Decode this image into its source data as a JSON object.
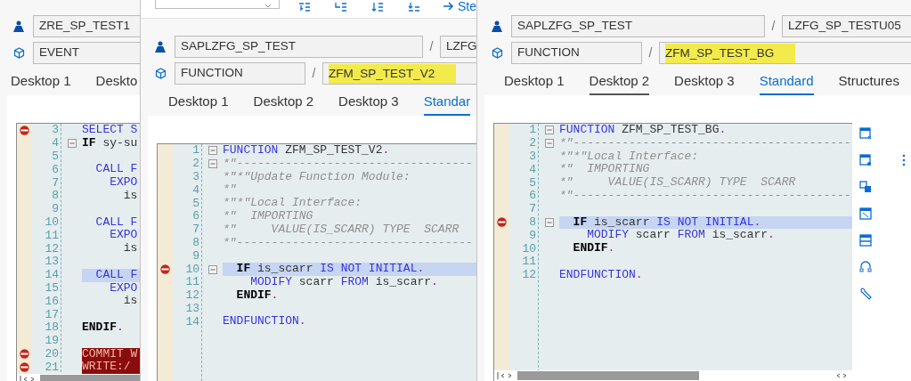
{
  "windows": [
    {
      "rows": [
        {
          "kind": "program",
          "items": [
            {
              "kind": "field",
              "value": "ZRE_SP_TEST1",
              "highlighted": false
            }
          ]
        },
        {
          "kind": "object",
          "items": [
            {
              "kind": "field",
              "value": "EVENT",
              "highlighted": false
            }
          ]
        }
      ],
      "tabs": [
        {
          "label": "Desktop 1",
          "selected": false,
          "focused": false
        },
        {
          "label": "Deskto",
          "selected": false,
          "focused": false
        }
      ],
      "editor": {
        "hscroll": true,
        "lines": [
          {
            "number": "3",
            "breakpoint": true,
            "fold": false,
            "current": false,
            "error": false,
            "segments": [
              {
                "kind": "keyword",
                "text": "SELECT S"
              }
            ]
          },
          {
            "number": "4",
            "breakpoint": false,
            "fold": true,
            "current": false,
            "error": false,
            "segments": [
              {
                "kind": "strong",
                "text": "IF"
              },
              {
                "kind": "ident",
                "text": " sy-su"
              }
            ]
          },
          {
            "number": "5",
            "breakpoint": false,
            "fold": false,
            "current": false,
            "error": false
          },
          {
            "number": "6",
            "breakpoint": false,
            "fold": false,
            "current": false,
            "error": false,
            "segments": [
              {
                "kind": "keyword",
                "text": "  CALL F"
              }
            ]
          },
          {
            "number": "7",
            "breakpoint": false,
            "fold": false,
            "current": false,
            "error": false,
            "segments": [
              {
                "kind": "keyword",
                "text": "    EXPO"
              }
            ]
          },
          {
            "number": "8",
            "breakpoint": false,
            "fold": false,
            "current": false,
            "error": false,
            "segments": [
              {
                "kind": "ident",
                "text": "      is"
              }
            ]
          },
          {
            "number": "9",
            "breakpoint": false,
            "fold": false,
            "current": false,
            "error": false
          },
          {
            "number": "10",
            "breakpoint": false,
            "fold": false,
            "current": false,
            "error": false,
            "segments": [
              {
                "kind": "keyword",
                "text": "  CALL F"
              }
            ]
          },
          {
            "number": "11",
            "breakpoint": false,
            "fold": false,
            "current": false,
            "error": false,
            "segments": [
              {
                "kind": "keyword",
                "text": "    EXPO"
              }
            ]
          },
          {
            "number": "12",
            "breakpoint": false,
            "fold": false,
            "current": false,
            "error": false,
            "segments": [
              {
                "kind": "ident",
                "text": "      is"
              }
            ]
          },
          {
            "number": "13",
            "breakpoint": false,
            "fold": false,
            "current": false,
            "error": false
          },
          {
            "number": "14",
            "breakpoint": false,
            "fold": false,
            "current": true,
            "error": false,
            "segments": [
              {
                "kind": "keyword",
                "text": "  CALL F"
              }
            ]
          },
          {
            "number": "15",
            "breakpoint": false,
            "fold": false,
            "current": false,
            "error": false,
            "segments": [
              {
                "kind": "keyword",
                "text": "    EXPO"
              }
            ]
          },
          {
            "number": "16",
            "breakpoint": false,
            "fold": false,
            "current": false,
            "error": false,
            "segments": [
              {
                "kind": "ident",
                "text": "      is"
              }
            ]
          },
          {
            "number": "17",
            "breakpoint": false,
            "fold": false,
            "current": false,
            "error": false
          },
          {
            "number": "18",
            "breakpoint": false,
            "fold": false,
            "current": false,
            "error": false,
            "segments": [
              {
                "kind": "strong",
                "text": "ENDIF"
              },
              {
                "kind": "dot",
                "text": "."
              }
            ]
          },
          {
            "number": "19",
            "breakpoint": false,
            "fold": false,
            "current": false,
            "error": false
          },
          {
            "number": "20",
            "breakpoint": true,
            "fold": false,
            "current": false,
            "error": true,
            "segments": [
              {
                "kind": "keyword",
                "text": "COMMIT W"
              }
            ]
          },
          {
            "number": "21",
            "breakpoint": true,
            "fold": false,
            "current": false,
            "error": true,
            "segments": [
              {
                "kind": "keyword",
                "text": "WRITE:/"
              }
            ]
          }
        ]
      }
    },
    {
      "toolbar": {
        "items": [
          {
            "kind": "dropdown"
          },
          {
            "kind": "tool"
          },
          {
            "kind": "tool"
          },
          {
            "kind": "tool"
          },
          {
            "kind": "tool"
          },
          {
            "kind": "button",
            "label": "Ste"
          }
        ]
      },
      "rows": [
        {
          "kind": "program",
          "items": [
            {
              "kind": "field",
              "value": "SAPLZFG_SP_TEST",
              "highlighted": false
            },
            {
              "kind": "separator",
              "text": "/"
            },
            {
              "kind": "field",
              "value": "LZFG",
              "highlighted": false
            }
          ]
        },
        {
          "kind": "object",
          "items": [
            {
              "kind": "field",
              "value": "FUNCTION",
              "highlighted": false
            },
            {
              "kind": "separator",
              "text": "/"
            },
            {
              "kind": "field",
              "value": "ZFM_SP_TEST_V2",
              "highlighted": true
            }
          ]
        }
      ],
      "tabs": [
        {
          "label": "Desktop 1",
          "selected": false,
          "focused": false
        },
        {
          "label": "Desktop 2",
          "selected": false,
          "focused": false
        },
        {
          "label": "Desktop 3",
          "selected": false,
          "focused": false
        },
        {
          "label": "Standar",
          "selected": true,
          "focused": false
        }
      ],
      "editor": {
        "lines": [
          {
            "number": "1",
            "breakpoint": false,
            "fold": true,
            "current": false,
            "error": false,
            "segments": [
              {
                "kind": "keyword",
                "text": "FUNCTION"
              },
              {
                "kind": "ident",
                "text": " ZFM_SP_TEST_V2"
              },
              {
                "kind": "dot",
                "text": "."
              }
            ]
          },
          {
            "number": "2",
            "breakpoint": false,
            "fold": true,
            "current": false,
            "error": false,
            "segments": [
              {
                "kind": "comment",
                "text": "*\"----------------------------------"
              }
            ]
          },
          {
            "number": "3",
            "breakpoint": false,
            "fold": false,
            "current": false,
            "error": false,
            "segments": [
              {
                "kind": "comment",
                "text": "*\"*\"Update Function Module:"
              }
            ]
          },
          {
            "number": "4",
            "breakpoint": false,
            "fold": false,
            "current": false,
            "error": false,
            "segments": [
              {
                "kind": "comment",
                "text": "*\""
              }
            ]
          },
          {
            "number": "5",
            "breakpoint": false,
            "fold": false,
            "current": false,
            "error": false,
            "segments": [
              {
                "kind": "comment",
                "text": "*\"*\"Local Interface:"
              }
            ]
          },
          {
            "number": "6",
            "breakpoint": false,
            "fold": false,
            "current": false,
            "error": false,
            "segments": [
              {
                "kind": "comment",
                "text": "*\"  IMPORTING"
              }
            ]
          },
          {
            "number": "7",
            "breakpoint": false,
            "fold": false,
            "current": false,
            "error": false,
            "segments": [
              {
                "kind": "comment",
                "text": "*\"     VALUE(IS_SCARR) TYPE  SCARR"
              }
            ]
          },
          {
            "number": "8",
            "breakpoint": false,
            "fold": false,
            "current": false,
            "error": false,
            "segments": [
              {
                "kind": "comment",
                "text": "*\"----------------------------------"
              }
            ]
          },
          {
            "number": "9",
            "breakpoint": false,
            "fold": false,
            "current": false,
            "error": false
          },
          {
            "number": "10",
            "breakpoint": true,
            "fold": true,
            "current": true,
            "error": false,
            "segments": [
              {
                "kind": "strong",
                "text": "  IF"
              },
              {
                "kind": "ident",
                "text": " is_scarr "
              },
              {
                "kind": "keyword",
                "text": "IS NOT INITIAL"
              },
              {
                "kind": "dot",
                "text": "."
              }
            ]
          },
          {
            "number": "11",
            "breakpoint": false,
            "fold": false,
            "current": false,
            "error": false,
            "segments": [
              {
                "kind": "keyword",
                "text": "    MODIFY"
              },
              {
                "kind": "ident",
                "text": " scarr "
              },
              {
                "kind": "keyword",
                "text": "FROM"
              },
              {
                "kind": "ident",
                "text": " is_scarr"
              },
              {
                "kind": "dot",
                "text": "."
              }
            ]
          },
          {
            "number": "12",
            "breakpoint": false,
            "fold": false,
            "current": false,
            "error": false,
            "segments": [
              {
                "kind": "strong",
                "text": "  ENDIF"
              },
              {
                "kind": "dot",
                "text": "."
              }
            ]
          },
          {
            "number": "13",
            "breakpoint": false,
            "fold": false,
            "current": false,
            "error": false
          },
          {
            "number": "14",
            "breakpoint": false,
            "fold": false,
            "current": false,
            "error": false,
            "segments": [
              {
                "kind": "keyword",
                "text": "ENDFUNCTION"
              },
              {
                "kind": "dot",
                "text": "."
              }
            ]
          }
        ]
      }
    },
    {
      "rows": [
        {
          "kind": "program",
          "items": [
            {
              "kind": "field",
              "value": "SAPLZFG_SP_TEST",
              "highlighted": false
            },
            {
              "kind": "separator",
              "text": "/"
            },
            {
              "kind": "field",
              "value": "LZFG_SP_TESTU05",
              "highlighted": false
            }
          ]
        },
        {
          "kind": "object",
          "items": [
            {
              "kind": "field",
              "value": "FUNCTION",
              "highlighted": false
            },
            {
              "kind": "separator",
              "text": "/"
            },
            {
              "kind": "field",
              "value": "ZFM_SP_TEST_BG",
              "highlighted": true
            }
          ]
        }
      ],
      "tabs": [
        {
          "label": "Desktop 1",
          "selected": false,
          "focused": false
        },
        {
          "label": "Desktop 2",
          "selected": false,
          "focused": true
        },
        {
          "label": "Desktop 3",
          "selected": false,
          "focused": false
        },
        {
          "label": "Standard",
          "selected": true,
          "focused": false
        },
        {
          "label": "Structures",
          "selected": false,
          "focused": false
        }
      ],
      "tool_strip": true,
      "editor": {
        "hscroll": true,
        "lines": [
          {
            "number": "1",
            "breakpoint": false,
            "fold": true,
            "current": false,
            "error": false,
            "segments": [
              {
                "kind": "keyword",
                "text": "FUNCTION"
              },
              {
                "kind": "ident",
                "text": " ZFM_SP_TEST_BG"
              },
              {
                "kind": "dot",
                "text": "."
              }
            ]
          },
          {
            "number": "2",
            "breakpoint": false,
            "fold": true,
            "current": false,
            "error": false,
            "segments": [
              {
                "kind": "comment",
                "text": "*\"----------------------------------------"
              }
            ]
          },
          {
            "number": "3",
            "breakpoint": false,
            "fold": false,
            "current": false,
            "error": false,
            "segments": [
              {
                "kind": "comment",
                "text": "*\"*\"Local Interface:"
              }
            ]
          },
          {
            "number": "4",
            "breakpoint": false,
            "fold": false,
            "current": false,
            "error": false,
            "segments": [
              {
                "kind": "comment",
                "text": "*\"  IMPORTING"
              }
            ]
          },
          {
            "number": "5",
            "breakpoint": false,
            "fold": false,
            "current": false,
            "error": false,
            "segments": [
              {
                "kind": "comment",
                "text": "*\"     VALUE(IS_SCARR) TYPE  SCARR"
              }
            ]
          },
          {
            "number": "6",
            "breakpoint": false,
            "fold": false,
            "current": false,
            "error": false,
            "segments": [
              {
                "kind": "comment",
                "text": "*\"----------------------------------------"
              }
            ]
          },
          {
            "number": "7",
            "breakpoint": false,
            "fold": false,
            "current": false,
            "error": false
          },
          {
            "number": "8",
            "breakpoint": true,
            "fold": true,
            "current": true,
            "error": false,
            "segments": [
              {
                "kind": "strong",
                "text": "  IF"
              },
              {
                "kind": "ident",
                "text": " is_scarr "
              },
              {
                "kind": "keyword",
                "text": "IS NOT INITIAL"
              },
              {
                "kind": "dot",
                "text": "."
              }
            ]
          },
          {
            "number": "9",
            "breakpoint": false,
            "fold": false,
            "current": false,
            "error": false,
            "segments": [
              {
                "kind": "keyword",
                "text": "    MODIFY"
              },
              {
                "kind": "ident",
                "text": " scarr "
              },
              {
                "kind": "keyword",
                "text": "FROM"
              },
              {
                "kind": "ident",
                "text": " is_scarr"
              },
              {
                "kind": "dot",
                "text": "."
              }
            ]
          },
          {
            "number": "10",
            "breakpoint": false,
            "fold": false,
            "current": false,
            "error": false,
            "segments": [
              {
                "kind": "strong",
                "text": "  ENDIF"
              },
              {
                "kind": "dot",
                "text": "."
              }
            ]
          },
          {
            "number": "11",
            "breakpoint": false,
            "fold": false,
            "current": false,
            "error": false
          },
          {
            "number": "12",
            "breakpoint": false,
            "fold": false,
            "current": false,
            "error": false,
            "segments": [
              {
                "kind": "keyword",
                "text": "ENDFUNCTION"
              },
              {
                "kind": "dot",
                "text": "."
              }
            ]
          }
        ]
      }
    }
  ]
}
